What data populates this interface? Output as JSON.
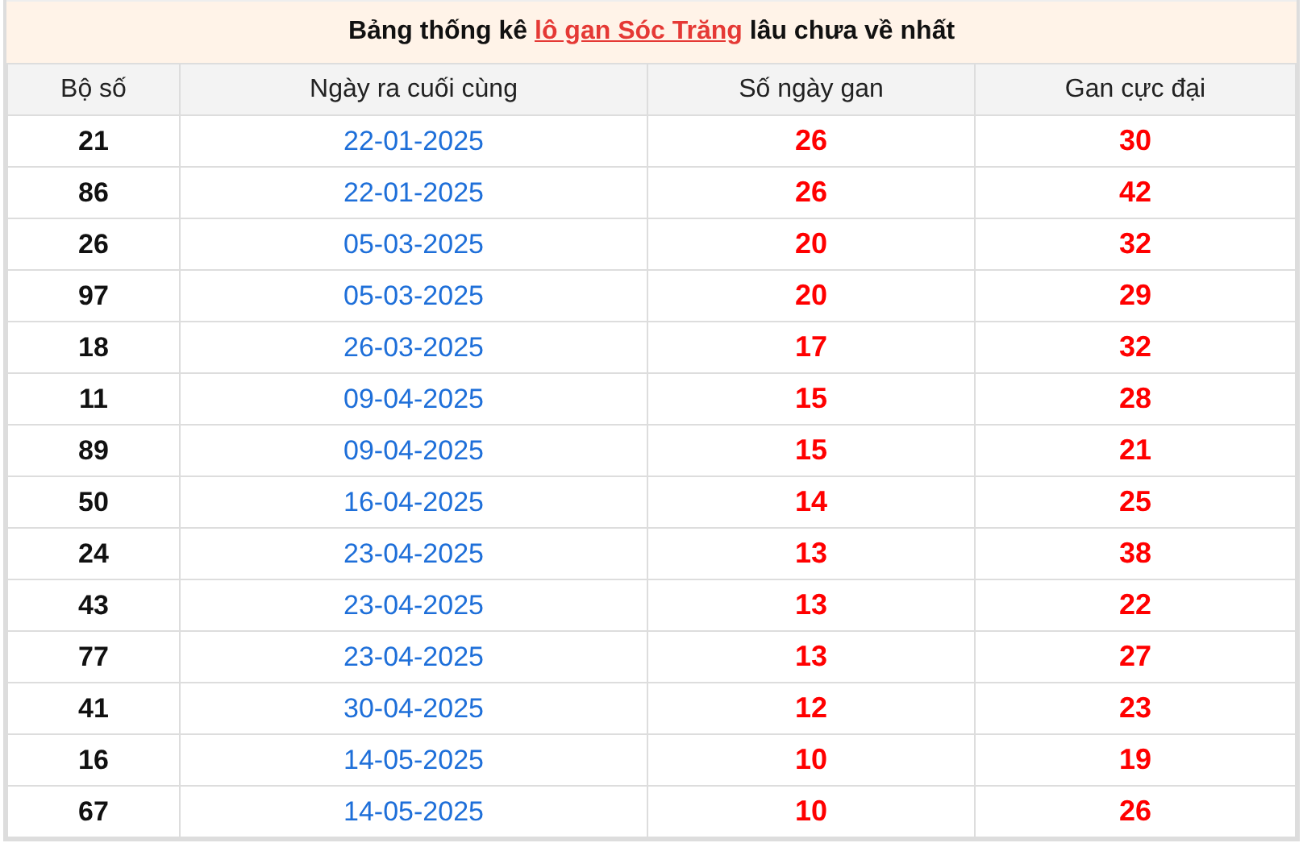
{
  "title": {
    "before": "Bảng thống kê ",
    "link": "lô gan Sóc Trăng",
    "after": " lâu chưa về nhất"
  },
  "table": {
    "columns": [
      "Bộ số",
      "Ngày ra cuối cùng",
      "Số ngày gan",
      "Gan cực đại"
    ],
    "rows": [
      [
        "21",
        "22-01-2025",
        "26",
        "30"
      ],
      [
        "86",
        "22-01-2025",
        "26",
        "42"
      ],
      [
        "26",
        "05-03-2025",
        "20",
        "32"
      ],
      [
        "97",
        "05-03-2025",
        "20",
        "29"
      ],
      [
        "18",
        "26-03-2025",
        "17",
        "32"
      ],
      [
        "11",
        "09-04-2025",
        "15",
        "28"
      ],
      [
        "89",
        "09-04-2025",
        "15",
        "21"
      ],
      [
        "50",
        "16-04-2025",
        "14",
        "25"
      ],
      [
        "24",
        "23-04-2025",
        "13",
        "38"
      ],
      [
        "43",
        "23-04-2025",
        "13",
        "22"
      ],
      [
        "77",
        "23-04-2025",
        "13",
        "27"
      ],
      [
        "41",
        "30-04-2025",
        "12",
        "23"
      ],
      [
        "16",
        "14-05-2025",
        "10",
        "19"
      ],
      [
        "67",
        "14-05-2025",
        "10",
        "26"
      ]
    ]
  }
}
